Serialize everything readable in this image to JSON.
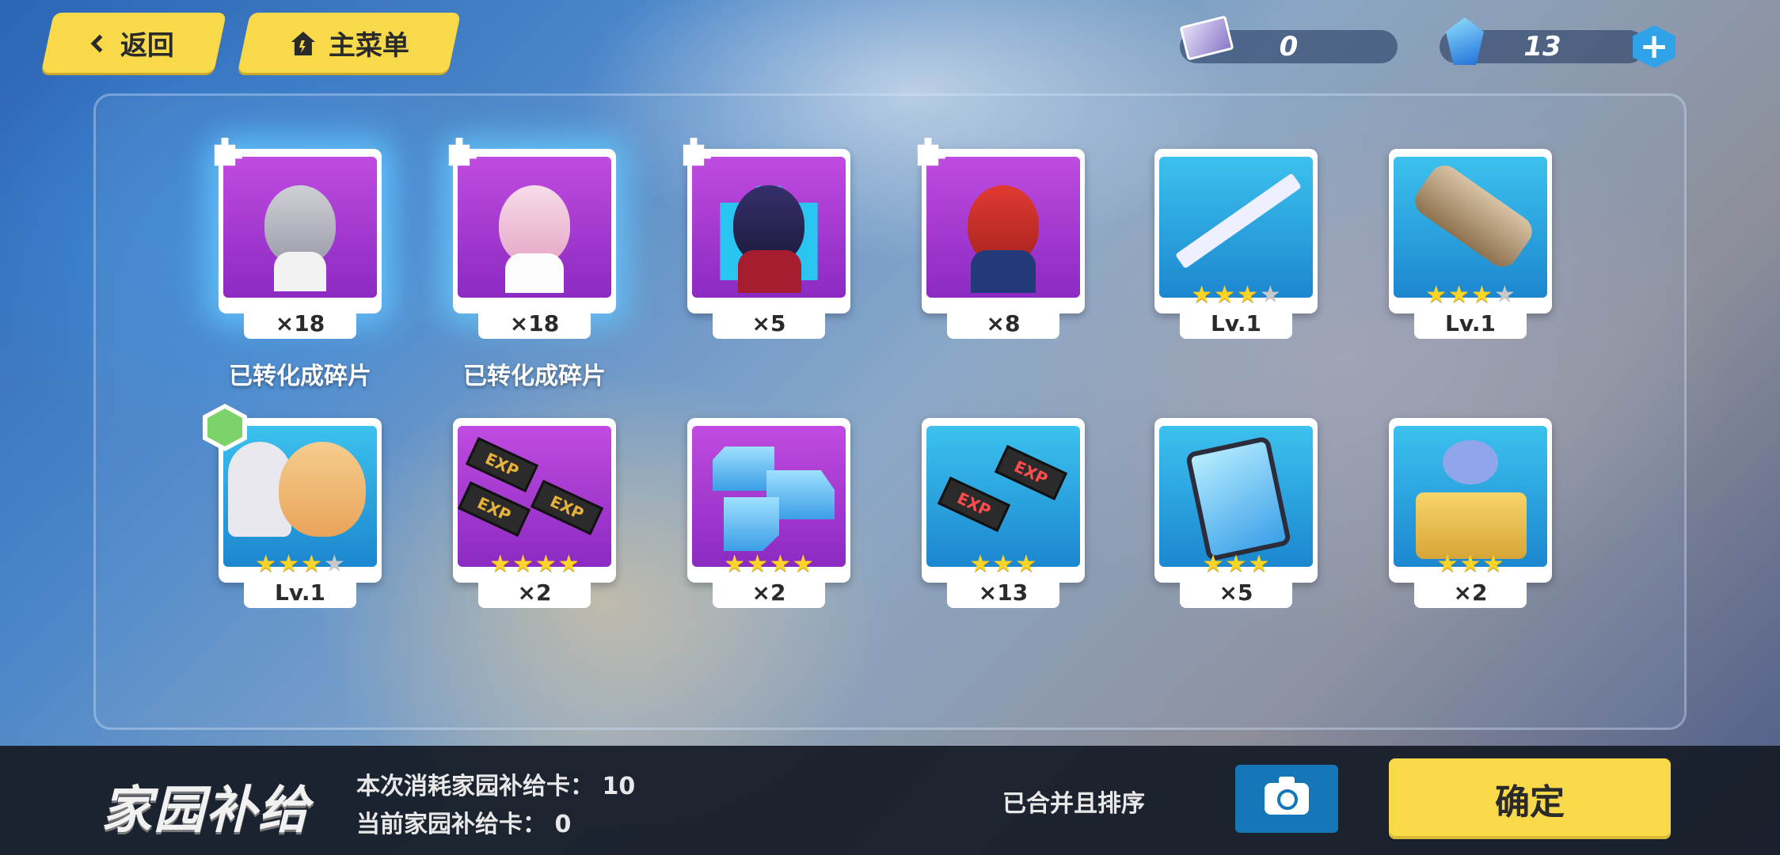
{
  "header": {
    "back_label": "返回",
    "menu_label": "主菜单",
    "currency_ticket": "0",
    "currency_crystal": "13",
    "add_label": "+"
  },
  "items_row1": [
    {
      "qty": "×18",
      "note": "已转化成碎片",
      "type": "fragment"
    },
    {
      "qty": "×18",
      "note": "已转化成碎片",
      "type": "fragment"
    },
    {
      "qty": "×5",
      "note": "",
      "type": "fragment"
    },
    {
      "qty": "×8",
      "note": "",
      "type": "fragment"
    },
    {
      "qty": "Lv.1",
      "stars": 3,
      "max_stars": 4,
      "type": "weapon"
    },
    {
      "qty": "Lv.1",
      "stars": 3,
      "max_stars": 4,
      "type": "weapon"
    }
  ],
  "items_row2": [
    {
      "qty": "Lv.1",
      "stars": 3,
      "max_stars": 4,
      "type": "stigmata"
    },
    {
      "qty": "×2",
      "stars": 4,
      "type": "exp-chip"
    },
    {
      "qty": "×2",
      "stars": 4,
      "type": "crystal"
    },
    {
      "qty": "×13",
      "stars": 3,
      "type": "exp-chip"
    },
    {
      "qty": "×5",
      "stars": 3,
      "type": "material"
    },
    {
      "qty": "×2",
      "stars": 3,
      "type": "coin-box"
    }
  ],
  "exp_text": "EXP",
  "footer": {
    "title": "家园补给",
    "consume_label": "本次消耗家园补给卡：",
    "consume_value": "10",
    "current_label": "当前家园补给卡：",
    "current_value": "0",
    "merged_label": "已合并且排序",
    "confirm_label": "确定"
  },
  "colors": {
    "accent_yellow": "#f7d94a",
    "purple_card": "#a53ad2",
    "blue_card": "#2aa3e0",
    "camera_blue": "#1677b8"
  }
}
